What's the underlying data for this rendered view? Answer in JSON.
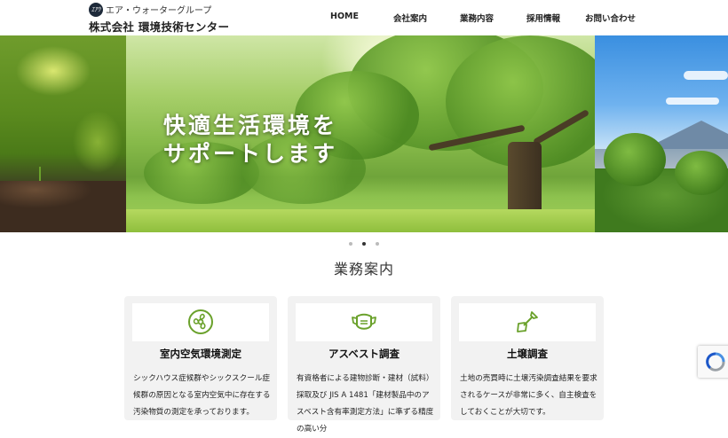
{
  "header": {
    "logo_mark": "ｴｱｳ",
    "group_name": "エア・ウォーターグループ",
    "company_name": "株式会社 環境技術センター",
    "nav": [
      "HOME",
      "会社案内",
      "業務内容",
      "採用情報",
      "お問い合わせ"
    ]
  },
  "hero": {
    "line1": "快適生活環境を",
    "line2": "サポートします",
    "slide_count": 3,
    "active_slide": 2
  },
  "services": {
    "title": "業務案内",
    "cards": [
      {
        "icon": "fan-icon",
        "title": "室内空気環境測定",
        "text": "シックハウス症候群やシックスクール症候群の原因となる室内空気中に存在する汚染物質の測定を承っております。"
      },
      {
        "icon": "mask-icon",
        "title": "アスベスト調査",
        "text": "有資格者による建物診断・建材（試料）採取及び JIS A 1481「建材製品中のアスベスト含有率測定方法」に準ずる精度の高い分"
      },
      {
        "icon": "shovel-icon",
        "title": "土壌調査",
        "text": "土地の売買時に土壌汚染調査結果を要求されるケースが非常に多く、自主検査をしておくことが大切です。"
      }
    ]
  },
  "colors": {
    "accent_green": "#6aa12b",
    "card_bg": "#f2f2f2"
  }
}
